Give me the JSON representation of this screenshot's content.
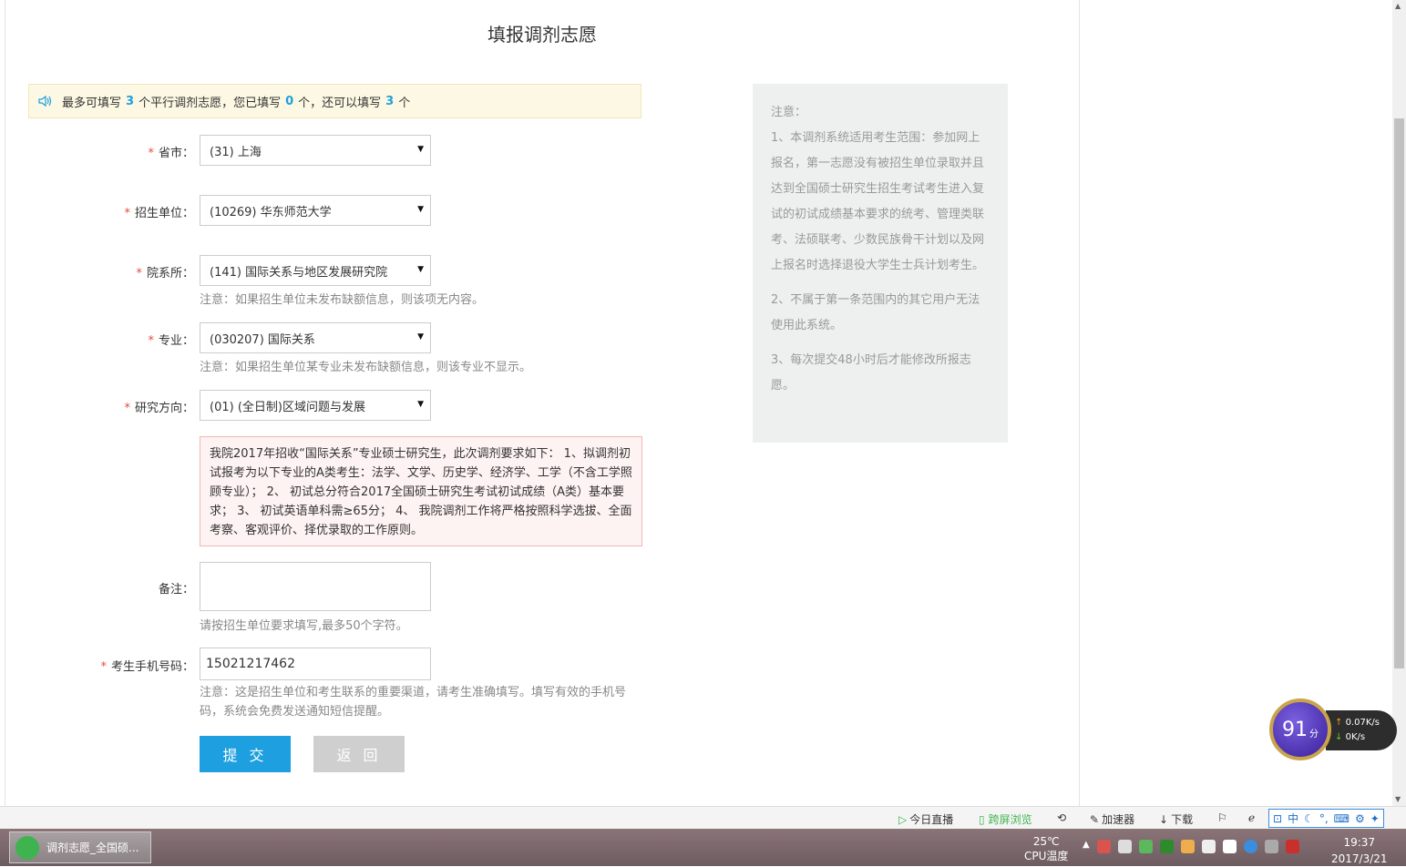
{
  "title": "填报调剂志愿",
  "info_bar": {
    "t1": "最多可填写",
    "max": "3",
    "t2": "个平行调剂志愿，您已填写",
    "filled": "0",
    "t3": "个，还可以填写",
    "remaining": "3",
    "t4": "个"
  },
  "form": {
    "province": {
      "label": "省市：",
      "value": "(31) 上海"
    },
    "unit": {
      "label": "招生单位：",
      "value": "(10269) 华东师范大学"
    },
    "dept": {
      "label": "院系所：",
      "value": "(141) 国际关系与地区发展研究院",
      "hint": "注意：如果招生单位未发布缺额信息，则该项无内容。"
    },
    "major": {
      "label": "专业：",
      "value": "(030207) 国际关系",
      "hint": "注意：如果招生单位某专业未发布缺额信息，则该专业不显示。"
    },
    "direction": {
      "label": "研究方向：",
      "value": "(01) (全日制)区域问题与发展"
    },
    "requirement_text": "我院2017年招收“国际关系”专业硕士研究生，此次调剂要求如下： 1、拟调剂初试报考为以下专业的A类考生：法学、文学、历史学、经济学、工学（不含工学照顾专业）； 2、 初试总分符合2017全国硕士研究生考试初试成绩（A类）基本要求； 3、 初试英语单科需≥65分； 4、 我院调剂工作将严格按照科学选拔、全面考察、客观评价、择优录取的工作原则。",
    "remark": {
      "label": "备注：",
      "value": "",
      "hint": "请按招生单位要求填写,最多50个字符。"
    },
    "phone": {
      "label": "考生手机号码：",
      "value": "15021217462",
      "hint": "注意：这是招生单位和考生联系的重要渠道，请考生准确填写。填写有效的手机号码，系统会免费发送通知短信提醒。"
    },
    "required_mark": "*"
  },
  "buttons": {
    "submit": "提 交",
    "back": "返 回"
  },
  "side_notice": {
    "title": "注意：",
    "items": [
      "1、本调剂系统适用考生范围：参加网上报名，第一志愿没有被招生单位录取并且达到全国硕士研究生招生考试考生进入复试的初试成绩基本要求的统考、管理类联考、法硕联考、少数民族骨干计划以及网上报名时选择退役大学生士兵计划考生。",
      "2、不属于第一条范围内的其它用户无法使用此系统。",
      "3、每次提交48小时后才能修改所报志愿。"
    ]
  },
  "score_widget": {
    "score": "91",
    "unit": "分",
    "up": "0.07K/s",
    "down": "0K/s"
  },
  "status_bar": {
    "live": "今日直播",
    "cross_screen": "跨屏浏览",
    "accelerator": "加速器",
    "download": "下载",
    "ime": "中"
  },
  "taskbar": {
    "task_label": "调剂志愿_全国硕...",
    "temp": "25℃",
    "temp_label": "CPU温度",
    "time": "19:37",
    "date": "2017/3/21"
  },
  "colors": {
    "accent": "#1e9fe0",
    "required": "#e84c3d",
    "notice_bg": "#fcf8e3",
    "red_box_bg": "#fdf3f2"
  }
}
